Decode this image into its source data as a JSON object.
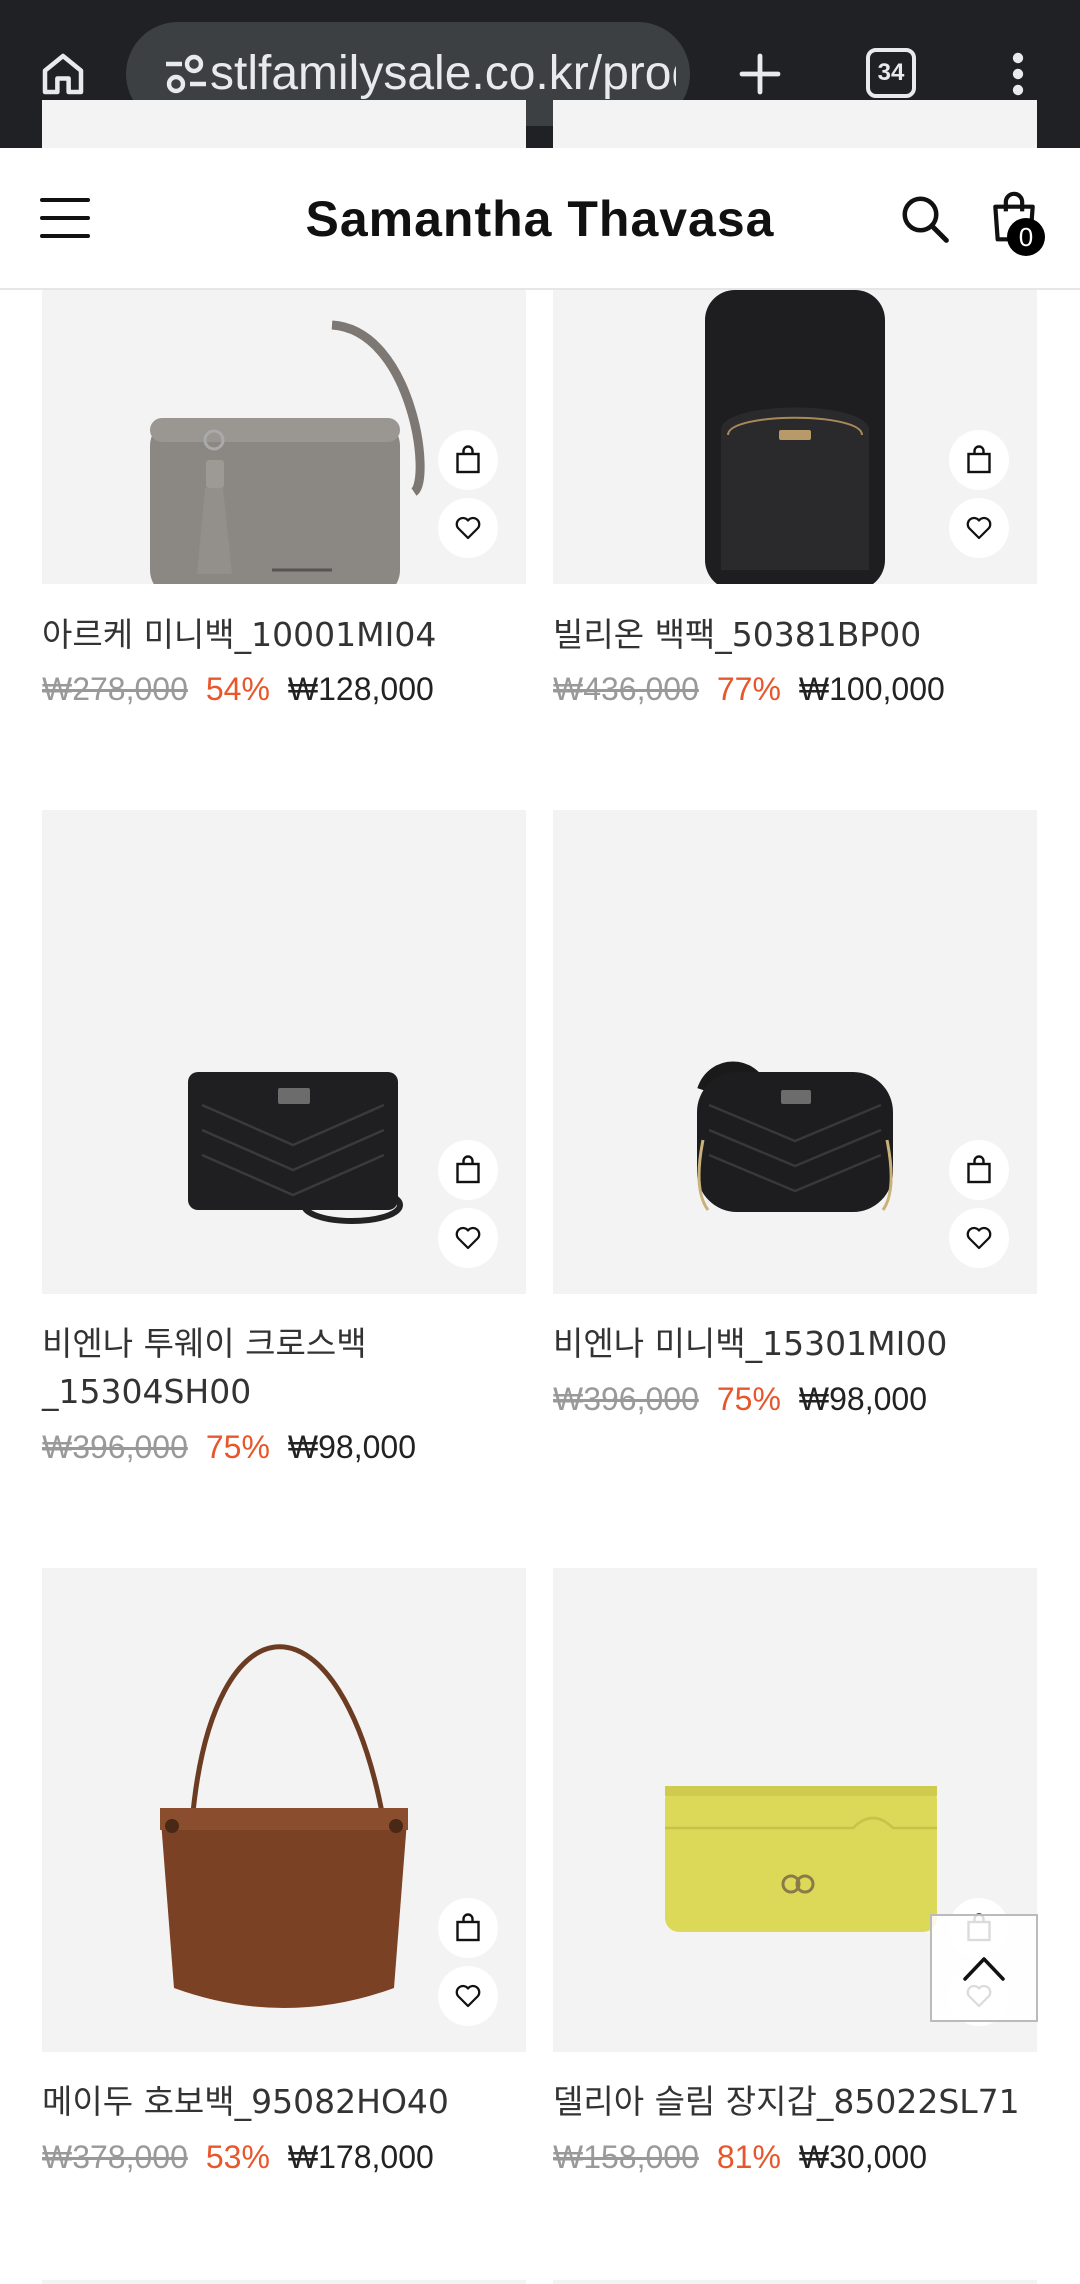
{
  "browser": {
    "url": "stlfamilysale.co.kr/product",
    "tab_count": "34"
  },
  "site": {
    "logo": "Samantha Thavasa",
    "cart_count": "0"
  },
  "products": [
    {
      "name": "아르케 미니백_10001MI04",
      "original_price": "₩278,000",
      "discount": "54%",
      "sale_price": "₩128,000"
    },
    {
      "name": "빌리온 백팩_50381BP00",
      "original_price": "₩436,000",
      "discount": "77%",
      "sale_price": "₩100,000"
    },
    {
      "name": "비엔나 투웨이 크로스백 _15304SH00",
      "original_price": "₩396,000",
      "discount": "75%",
      "sale_price": "₩98,000"
    },
    {
      "name": "비엔나 미니백_15301MI00",
      "original_price": "₩396,000",
      "discount": "75%",
      "sale_price": "₩98,000"
    },
    {
      "name": "메이두 호보백_95082HO40",
      "original_price": "₩378,000",
      "discount": "53%",
      "sale_price": "₩178,000"
    },
    {
      "name": "델리아 슬림 장지갑_85022SL71",
      "original_price": "₩158,000",
      "discount": "81%",
      "sale_price": "₩30,000"
    }
  ],
  "colors": {
    "discount": "#e8572b",
    "chrome_bg": "#202124",
    "image_bg": "#f3f3f3"
  },
  "icons": [
    "home-icon",
    "site-info-icon",
    "plus-icon",
    "tabs-icon",
    "more-vert-icon",
    "hamburger-icon",
    "search-icon",
    "shopping-bag-icon",
    "cart-icon",
    "heart-icon",
    "chevron-up-icon"
  ]
}
